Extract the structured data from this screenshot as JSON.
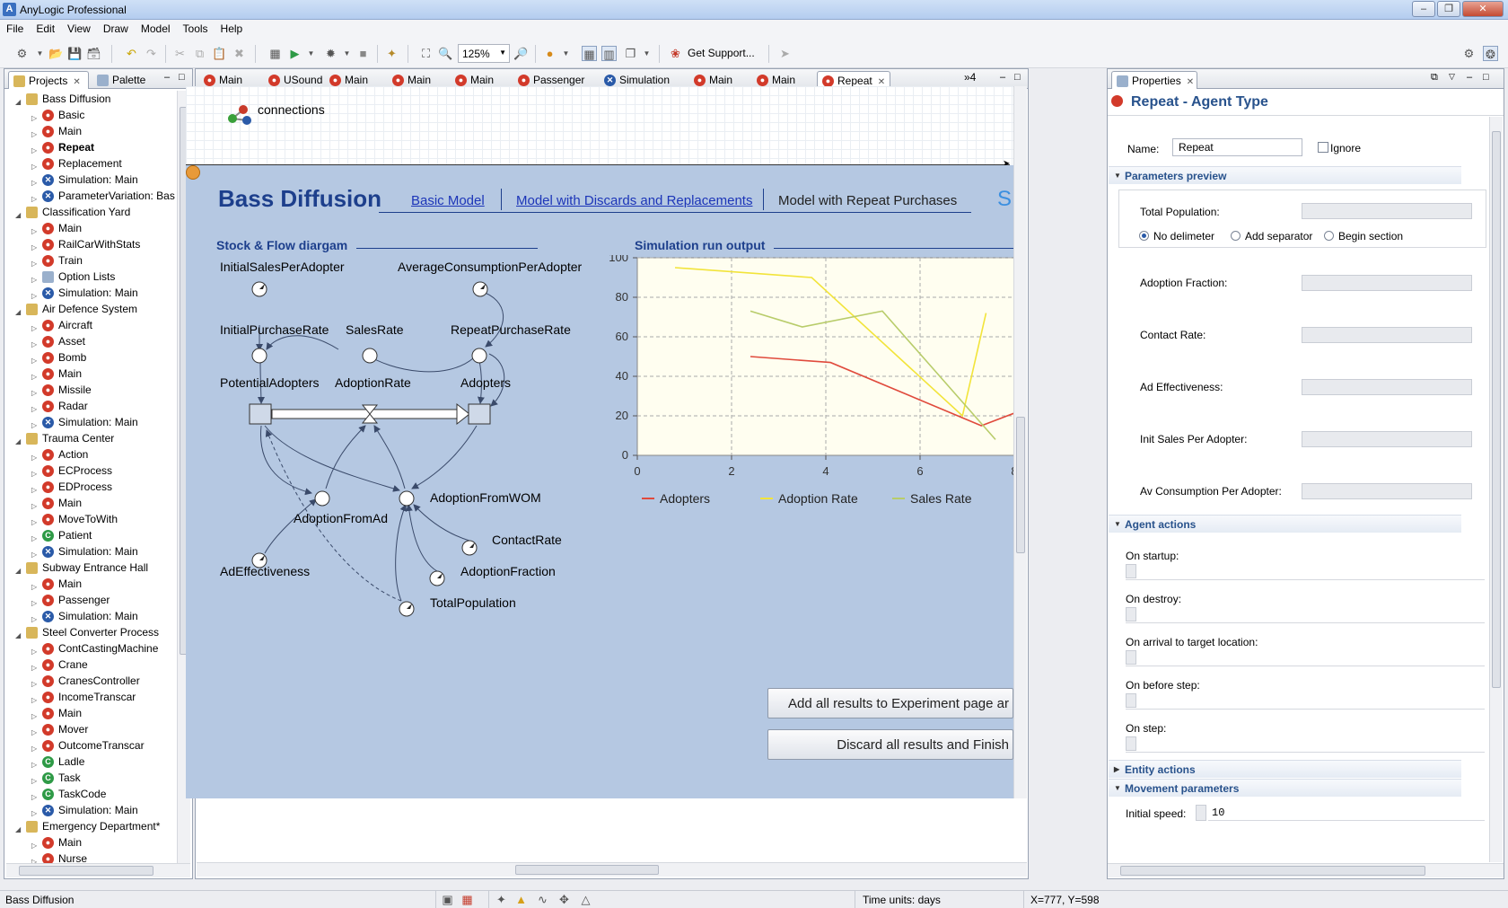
{
  "window": {
    "title": "AnyLogic Professional",
    "logo": "A"
  },
  "menu": [
    "File",
    "Edit",
    "View",
    "Draw",
    "Model",
    "Tools",
    "Help"
  ],
  "toolbar": {
    "zoom": "125%",
    "support_label": "Get Support..."
  },
  "left_tabs": {
    "projects": "Projects",
    "palette": "Palette"
  },
  "tree": [
    {
      "label": "Bass Diffusion",
      "level": 0,
      "icon": "package-icon",
      "bold": false
    },
    {
      "label": "Basic",
      "level": 1,
      "icon": "agent-icon"
    },
    {
      "label": "Main",
      "level": 1,
      "icon": "agent-icon"
    },
    {
      "label": "Repeat",
      "level": 1,
      "icon": "agent-icon",
      "bold": true
    },
    {
      "label": "Replacement",
      "level": 1,
      "icon": "agent-icon"
    },
    {
      "label": "Simulation: Main",
      "level": 1,
      "icon": "experiment-icon"
    },
    {
      "label": "ParameterVariation: Bas",
      "level": 1,
      "icon": "experiment-icon"
    },
    {
      "label": "Classification Yard",
      "level": 0,
      "icon": "package-icon"
    },
    {
      "label": "Main",
      "level": 1,
      "icon": "agent-icon"
    },
    {
      "label": "RailCarWithStats",
      "level": 1,
      "icon": "agent-icon"
    },
    {
      "label": "Train",
      "level": 1,
      "icon": "agent-icon"
    },
    {
      "label": "Option Lists",
      "level": 1,
      "icon": "option-list-icon"
    },
    {
      "label": "Simulation: Main",
      "level": 1,
      "icon": "experiment-icon"
    },
    {
      "label": "Air Defence System",
      "level": 0,
      "icon": "package-icon"
    },
    {
      "label": "Aircraft",
      "level": 1,
      "icon": "agent-icon"
    },
    {
      "label": "Asset",
      "level": 1,
      "icon": "agent-icon"
    },
    {
      "label": "Bomb",
      "level": 1,
      "icon": "agent-icon"
    },
    {
      "label": "Main",
      "level": 1,
      "icon": "agent-icon"
    },
    {
      "label": "Missile",
      "level": 1,
      "icon": "agent-icon"
    },
    {
      "label": "Radar",
      "level": 1,
      "icon": "agent-icon"
    },
    {
      "label": "Simulation: Main",
      "level": 1,
      "icon": "experiment-icon"
    },
    {
      "label": "Trauma Center",
      "level": 0,
      "icon": "package-icon"
    },
    {
      "label": "Action",
      "level": 1,
      "icon": "agent-icon"
    },
    {
      "label": "ECProcess",
      "level": 1,
      "icon": "agent-icon"
    },
    {
      "label": "EDProcess",
      "level": 1,
      "icon": "agent-icon"
    },
    {
      "label": "Main",
      "level": 1,
      "icon": "agent-icon"
    },
    {
      "label": "MoveToWith",
      "level": 1,
      "icon": "agent-icon"
    },
    {
      "label": "Patient",
      "level": 1,
      "icon": "java-class-icon"
    },
    {
      "label": "Simulation: Main",
      "level": 1,
      "icon": "experiment-icon"
    },
    {
      "label": "Subway Entrance Hall",
      "level": 0,
      "icon": "package-icon"
    },
    {
      "label": "Main",
      "level": 1,
      "icon": "agent-icon"
    },
    {
      "label": "Passenger",
      "level": 1,
      "icon": "agent-icon"
    },
    {
      "label": "Simulation: Main",
      "level": 1,
      "icon": "experiment-icon"
    },
    {
      "label": "Steel Converter Process",
      "level": 0,
      "icon": "package-icon"
    },
    {
      "label": "ContCastingMachine",
      "level": 1,
      "icon": "agent-icon"
    },
    {
      "label": "Crane",
      "level": 1,
      "icon": "agent-icon"
    },
    {
      "label": "CranesController",
      "level": 1,
      "icon": "agent-icon"
    },
    {
      "label": "IncomeTranscar",
      "level": 1,
      "icon": "agent-icon"
    },
    {
      "label": "Main",
      "level": 1,
      "icon": "agent-icon"
    },
    {
      "label": "Mover",
      "level": 1,
      "icon": "agent-icon"
    },
    {
      "label": "OutcomeTranscar",
      "level": 1,
      "icon": "agent-icon"
    },
    {
      "label": "Ladle",
      "level": 1,
      "icon": "java-class-icon"
    },
    {
      "label": "Task",
      "level": 1,
      "icon": "java-class-icon"
    },
    {
      "label": "TaskCode",
      "level": 1,
      "icon": "java-class-icon"
    },
    {
      "label": "Simulation: Main",
      "level": 1,
      "icon": "experiment-icon"
    },
    {
      "label": "Emergency Department*",
      "level": 0,
      "icon": "package-icon"
    },
    {
      "label": "Main",
      "level": 1,
      "icon": "agent-icon"
    },
    {
      "label": "Nurse",
      "level": 1,
      "icon": "agent-icon"
    }
  ],
  "editor_tabs": [
    {
      "label": "Main",
      "icon": "agent-icon"
    },
    {
      "label": "USound",
      "icon": "agent-icon"
    },
    {
      "label": "Main",
      "icon": "agent-icon"
    },
    {
      "label": "Main",
      "icon": "agent-icon"
    },
    {
      "label": "Main",
      "icon": "agent-icon"
    },
    {
      "label": "Passenger",
      "icon": "agent-icon"
    },
    {
      "label": "Simulation",
      "icon": "experiment-icon"
    },
    {
      "label": "Main",
      "icon": "agent-icon"
    },
    {
      "label": "Main",
      "icon": "agent-icon"
    },
    {
      "label": "Repeat",
      "icon": "agent-icon",
      "selected": true
    }
  ],
  "editor_overflow": "»4",
  "canvas": {
    "connections_label": "connections",
    "model_title": "Bass Diffusion",
    "nav_basic": "Basic Model",
    "nav_discards": "Model with Discards and Replacements",
    "nav_repeat": "Model with Repeat Purchases",
    "nav_cut": "S",
    "sfd_heading": "Stock & Flow diargam",
    "chart_heading": "Simulation run output",
    "sfd_labels": {
      "initial_sales": "InitialSalesPerAdopter",
      "avg_consumption": "AverageConsumptionPerAdopter",
      "initial_purchase": "InitialPurchaseRate",
      "sales_rate": "SalesRate",
      "repeat_purchase": "RepeatPurchaseRate",
      "potential": "PotentialAdopters",
      "adoption_rate": "AdoptionRate",
      "adopters": "Adopters",
      "adoption_wom": "AdoptionFromWOM",
      "adoption_ad": "AdoptionFromAd",
      "contact_rate": "ContactRate",
      "ad_effectiveness": "AdEffectiveness",
      "adoption_fraction": "AdoptionFraction",
      "total_population": "TotalPopulation"
    },
    "btn_add": "Add all results to Experiment page ar",
    "btn_discard": "Discard all results and Finish"
  },
  "chart_data": {
    "type": "line",
    "title": "Simulation run output",
    "xlim": [
      0,
      8
    ],
    "ylim": [
      0,
      100
    ],
    "xticks": [
      0,
      2,
      4,
      6,
      8
    ],
    "yticks": [
      0,
      20,
      40,
      60,
      80,
      100
    ],
    "grid": true,
    "legend": "bottom",
    "series": [
      {
        "name": "Adopters",
        "color": "#e04a3c",
        "points": [
          [
            2.4,
            50
          ],
          [
            4.1,
            47
          ],
          [
            7.3,
            15
          ],
          [
            8.4,
            25
          ]
        ]
      },
      {
        "name": "Adoption Rate",
        "color": "#f2e43a",
        "points": [
          [
            0.8,
            95
          ],
          [
            3.7,
            90
          ],
          [
            6.9,
            20
          ],
          [
            7.4,
            72
          ]
        ]
      },
      {
        "name": "Sales Rate",
        "color": "#b8cc6a",
        "points": [
          [
            2.4,
            73
          ],
          [
            3.5,
            65
          ],
          [
            5.2,
            73
          ],
          [
            7.6,
            8
          ]
        ]
      }
    ]
  },
  "properties": {
    "tab": "Properties",
    "header": "Repeat - Agent Type",
    "name_label": "Name:",
    "name_value": "Repeat",
    "ignore_label": "Ignore",
    "sec_params": "Parameters preview",
    "total_population": "Total Population:",
    "radio_no_delim": "No delimeter",
    "radio_sep": "Add separator",
    "radio_begin": "Begin section",
    "adoption_fraction": "Adoption Fraction:",
    "contact_rate": "Contact Rate:",
    "ad_effectiveness": "Ad Effectiveness:",
    "init_sales": "Init Sales Per Adopter:",
    "av_consumption": "Av Consumption Per Adopter:",
    "sec_agent_actions": "Agent actions",
    "on_startup": "On startup:",
    "on_destroy": "On destroy:",
    "on_arrival": "On arrival to target location:",
    "on_before_step": "On before step:",
    "on_step": "On step:",
    "sec_entity": "Entity actions",
    "sec_movement": "Movement parameters",
    "initial_speed_label": "Initial speed:",
    "initial_speed_value": "10"
  },
  "status": {
    "left": "Bass Diffusion",
    "time_units": "Time units: days",
    "coords": "X=777, Y=598"
  },
  "colors": {
    "model_title": "#1d3f8c",
    "heading": "#1d3f8c",
    "sfd_bg": "#b5c8e2",
    "chart_bg": "#fffef0"
  }
}
